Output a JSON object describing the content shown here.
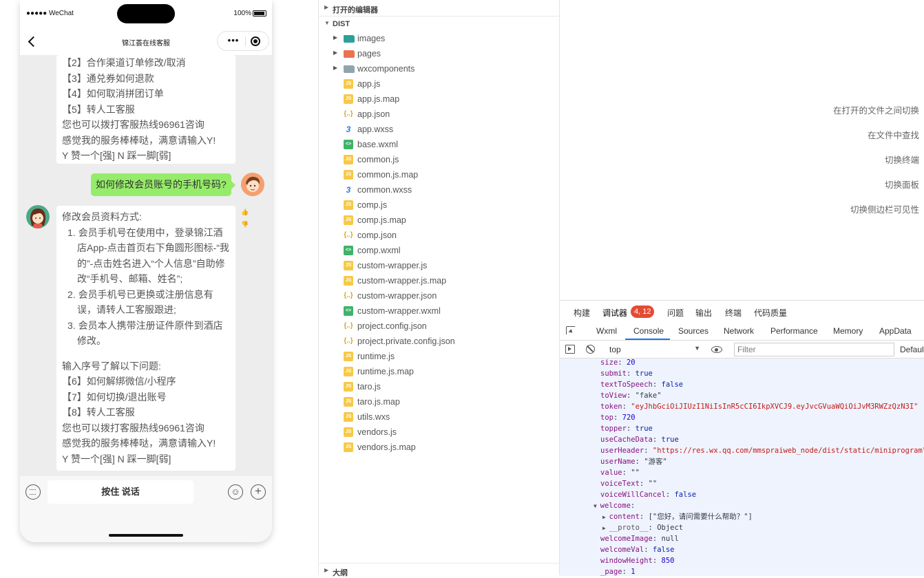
{
  "phone": {
    "status_left": "●●●●● WeChat",
    "status_right": "100%",
    "nav_title": "锦江荟在线客服",
    "capsule_more": "•••",
    "bubble1_lines": [
      "【2】合作渠道订单修改/取消",
      "【3】通兑券如何退款",
      "【4】如何取消拼团订单",
      "【5】转人工客服",
      "您也可以拨打客服热线96961咨询",
      "感觉我的服务棒棒哒，满意请输入Y!",
      "Y 赞一个[强] N 踩一脚[弱]"
    ],
    "user_message": "如何修改会员账号的手机号码?",
    "bubble2": {
      "intro": "修改会员资料方式:",
      "items": [
        "1. 会员手机号在使用中，登录锦江酒店App-点击首页右下角圆形图标-“我的”-点击姓名进入“个人信息”自助修改“手机号、邮箱、姓名”;",
        "2. 会员手机号已更换或注册信息有误，请转人工客服跟进;",
        "3. 会员本人携带注册证件原件到酒店修改。"
      ],
      "lines_after": [
        "输入序号了解以下问题:",
        "【6】如何解绑微信/小程序",
        "【7】如何切换/退出账号",
        "【8】转人工客服",
        "您也可以拨打客服热线96961咨询",
        "感觉我的服务棒棒哒，满意请输入Y!",
        "Y 赞一个[强] N 踩一脚[弱]"
      ]
    },
    "hold_to_talk": "按住 说话",
    "plus": "+"
  },
  "explorer": {
    "open_editors": "打开的编辑器",
    "dist": "DIST",
    "outline": "大纲",
    "files": [
      {
        "name": "images",
        "kind": "folder",
        "color": "#2aa198"
      },
      {
        "name": "pages",
        "kind": "folder",
        "color": "#e8744f"
      },
      {
        "name": "wxcomponents",
        "kind": "folder",
        "color": "#90a4ae"
      },
      {
        "name": "app.js",
        "kind": "js"
      },
      {
        "name": "app.js.map",
        "kind": "js"
      },
      {
        "name": "app.json",
        "kind": "json"
      },
      {
        "name": "app.wxss",
        "kind": "wxss"
      },
      {
        "name": "base.wxml",
        "kind": "wxml"
      },
      {
        "name": "common.js",
        "kind": "js"
      },
      {
        "name": "common.js.map",
        "kind": "js"
      },
      {
        "name": "common.wxss",
        "kind": "wxss"
      },
      {
        "name": "comp.js",
        "kind": "js"
      },
      {
        "name": "comp.js.map",
        "kind": "js"
      },
      {
        "name": "comp.json",
        "kind": "json"
      },
      {
        "name": "comp.wxml",
        "kind": "wxml"
      },
      {
        "name": "custom-wrapper.js",
        "kind": "js"
      },
      {
        "name": "custom-wrapper.js.map",
        "kind": "js"
      },
      {
        "name": "custom-wrapper.json",
        "kind": "json"
      },
      {
        "name": "custom-wrapper.wxml",
        "kind": "wxml"
      },
      {
        "name": "project.config.json",
        "kind": "json"
      },
      {
        "name": "project.private.config.json",
        "kind": "json"
      },
      {
        "name": "runtime.js",
        "kind": "js"
      },
      {
        "name": "runtime.js.map",
        "kind": "js"
      },
      {
        "name": "taro.js",
        "kind": "js"
      },
      {
        "name": "taro.js.map",
        "kind": "js"
      },
      {
        "name": "utils.wxs",
        "kind": "js"
      },
      {
        "name": "vendors.js",
        "kind": "js"
      },
      {
        "name": "vendors.js.map",
        "kind": "js"
      }
    ]
  },
  "hints": [
    "在打开的文件之间切换",
    "在文件中查找",
    "切换终端",
    "切换面板",
    "切换侧边栏可见性"
  ],
  "devtools": {
    "top_tabs": [
      "构建",
      "调试器",
      "问题",
      "输出",
      "终端",
      "代码质量"
    ],
    "badge": "4, 12",
    "panel_tabs": [
      "Wxml",
      "Console",
      "Sources",
      "Network",
      "Performance",
      "Memory",
      "AppData"
    ],
    "context": "top",
    "filter_placeholder": "Filter",
    "levels": "Default levels",
    "console_lines": [
      {
        "key": "size",
        "val": "20",
        "t": "n",
        "ind": 0
      },
      {
        "key": "submit",
        "val": "true",
        "t": "b",
        "ind": 0
      },
      {
        "key": "textToSpeech",
        "val": "false",
        "t": "b",
        "ind": 0
      },
      {
        "key": "toView",
        "val": "\"fake\"",
        "t": "o",
        "ind": 0
      },
      {
        "key": "token",
        "val": "\"eyJhbGciOiJIUzI1NiIsInR5cCI6IkpXVCJ9.eyJvcGVuaWQiOiJvM3RWZzQzN3I\"",
        "t": "s",
        "ind": 0
      },
      {
        "key": "top",
        "val": "720",
        "t": "n",
        "ind": 0
      },
      {
        "key": "topper",
        "val": "true",
        "t": "b",
        "ind": 0
      },
      {
        "key": "useCacheData",
        "val": "true",
        "t": "b",
        "ind": 0
      },
      {
        "key": "userHeader",
        "val": "\"https://res.wx.qq.com/mmspraiweb_node/dist/static/miniprogram\"",
        "t": "s",
        "ind": 0
      },
      {
        "key": "userName",
        "val": "\"游客\"",
        "t": "o",
        "ind": 0
      },
      {
        "key": "value",
        "val": "\"\"",
        "t": "o",
        "ind": 0
      },
      {
        "key": "voiceText",
        "val": "\"\"",
        "t": "o",
        "ind": 0
      },
      {
        "key": "voiceWillCancel",
        "val": "false",
        "t": "b",
        "ind": 0
      },
      {
        "key": "welcome",
        "val": "",
        "t": "o",
        "ind": 0,
        "tri": "▼"
      },
      {
        "key": "content",
        "val": "[\"您好，请问需要什么帮助？\"]",
        "t": "o",
        "ind": 1,
        "tri": "▶",
        "arr": true
      },
      {
        "key": "__proto__",
        "val": "Object",
        "t": "o",
        "ind": 1,
        "tri": "▶",
        "proto": true
      },
      {
        "key": "welcomeImage",
        "val": "null",
        "t": "o",
        "ind": 0
      },
      {
        "key": "welcomeVal",
        "val": "false",
        "t": "b",
        "ind": 0
      },
      {
        "key": "windowHeight",
        "val": "850",
        "t": "n",
        "ind": 0
      },
      {
        "key": "_page",
        "val": "1",
        "t": "n",
        "ind": 0
      }
    ]
  }
}
